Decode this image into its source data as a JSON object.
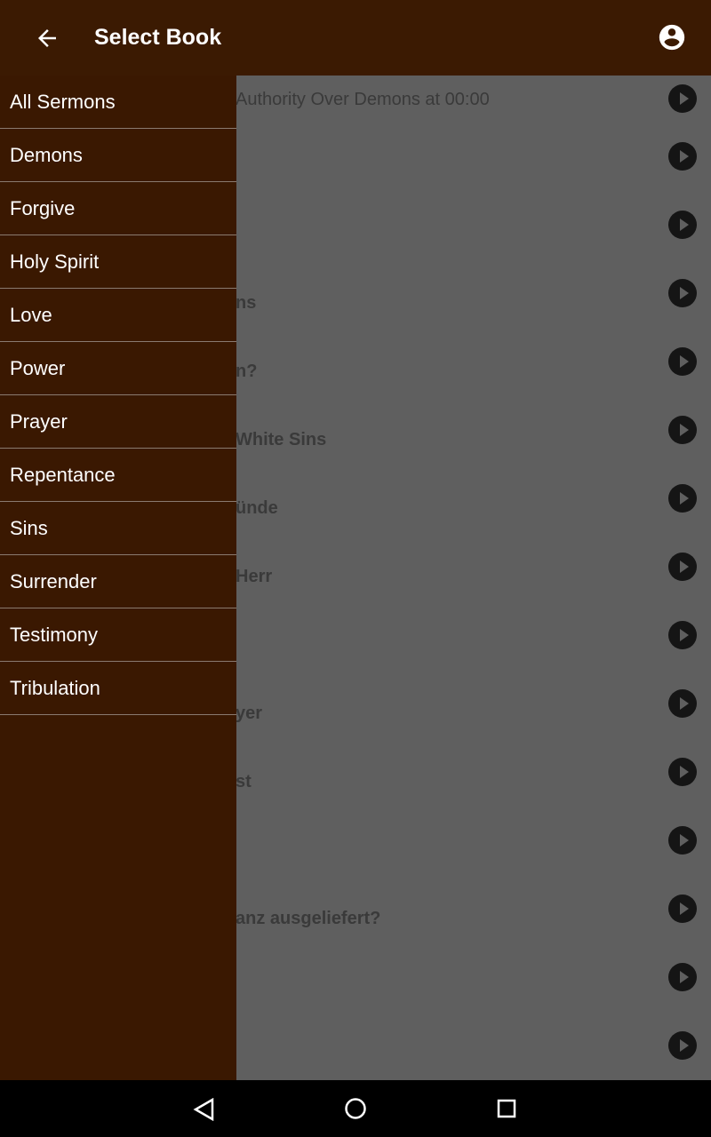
{
  "appbar": {
    "title": "Select Book",
    "back_icon": "arrow-left-icon",
    "account_icon": "account-circle-icon"
  },
  "drawer": {
    "items": [
      "All Sermons",
      "Demons",
      "Forgive",
      "Holy Spirit",
      "Love",
      "Power",
      "Prayer",
      "Repentance",
      "Sins",
      "Surrender",
      "Testimony",
      "Tribulation"
    ]
  },
  "list": {
    "rows": [
      {
        "text": "Authority Over Demons at 00:00",
        "bold": false
      },
      {
        "text": "",
        "bold": true
      },
      {
        "text": "",
        "bold": true
      },
      {
        "text": "ns",
        "bold": true
      },
      {
        "text": "n?",
        "bold": true
      },
      {
        "text": "White Sins",
        "bold": true
      },
      {
        "text": "ünde",
        "bold": true
      },
      {
        "text": " Herr",
        "bold": true
      },
      {
        "text": "",
        "bold": true
      },
      {
        "text": "yer",
        "bold": true
      },
      {
        "text": "st",
        "bold": true
      },
      {
        "text": "",
        "bold": true
      },
      {
        "text": "anz ausgeliefert?",
        "bold": true
      },
      {
        "text": "",
        "bold": true
      },
      {
        "text": "",
        "bold": true
      }
    ],
    "play_icon": "play-circle-icon"
  },
  "navbar": {
    "icons": [
      "back-triangle-icon",
      "home-circle-icon",
      "recents-square-icon"
    ]
  }
}
